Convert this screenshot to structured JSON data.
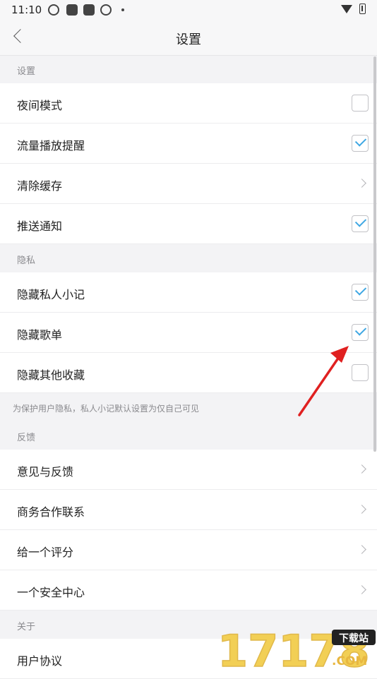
{
  "status_bar": {
    "time": "11:10",
    "icons": [
      "app-icon",
      "app-icon",
      "app-icon",
      "app-icon",
      "wifi-icon",
      "battery-icon"
    ]
  },
  "nav": {
    "title": "设置"
  },
  "sections": {
    "settings": {
      "header": "设置",
      "items": [
        {
          "label": "夜间模式",
          "control": "checkbox",
          "checked": false
        },
        {
          "label": "流量播放提醒",
          "control": "checkbox",
          "checked": true
        },
        {
          "label": "清除缓存",
          "control": "chevron"
        },
        {
          "label": "推送通知",
          "control": "checkbox",
          "checked": true
        }
      ]
    },
    "privacy": {
      "header": "隐私",
      "items": [
        {
          "label": "隐藏私人小记",
          "control": "checkbox",
          "checked": true
        },
        {
          "label": "隐藏歌单",
          "control": "checkbox",
          "checked": true
        },
        {
          "label": "隐藏其他收藏",
          "control": "checkbox",
          "checked": false
        }
      ],
      "note": "为保护用户隐私，私人小记默认设置为仅自己可见"
    },
    "feedback": {
      "header": "反馈",
      "items": [
        {
          "label": "意见与反馈",
          "control": "chevron"
        },
        {
          "label": "商务合作联系",
          "control": "chevron"
        },
        {
          "label": "给一个评分",
          "control": "chevron"
        },
        {
          "label": "一个安全中心",
          "control": "chevron"
        }
      ]
    },
    "about": {
      "header": "关于",
      "items": [
        {
          "label": "用户协议",
          "control": "chevron"
        }
      ]
    }
  },
  "annotation": {
    "color": "#e02020"
  },
  "watermark": {
    "text": "17178",
    "badge": "下载站",
    "suffix": ".COM"
  },
  "colors": {
    "accent": "#3fa7e3",
    "background": "#f3f3f5"
  }
}
